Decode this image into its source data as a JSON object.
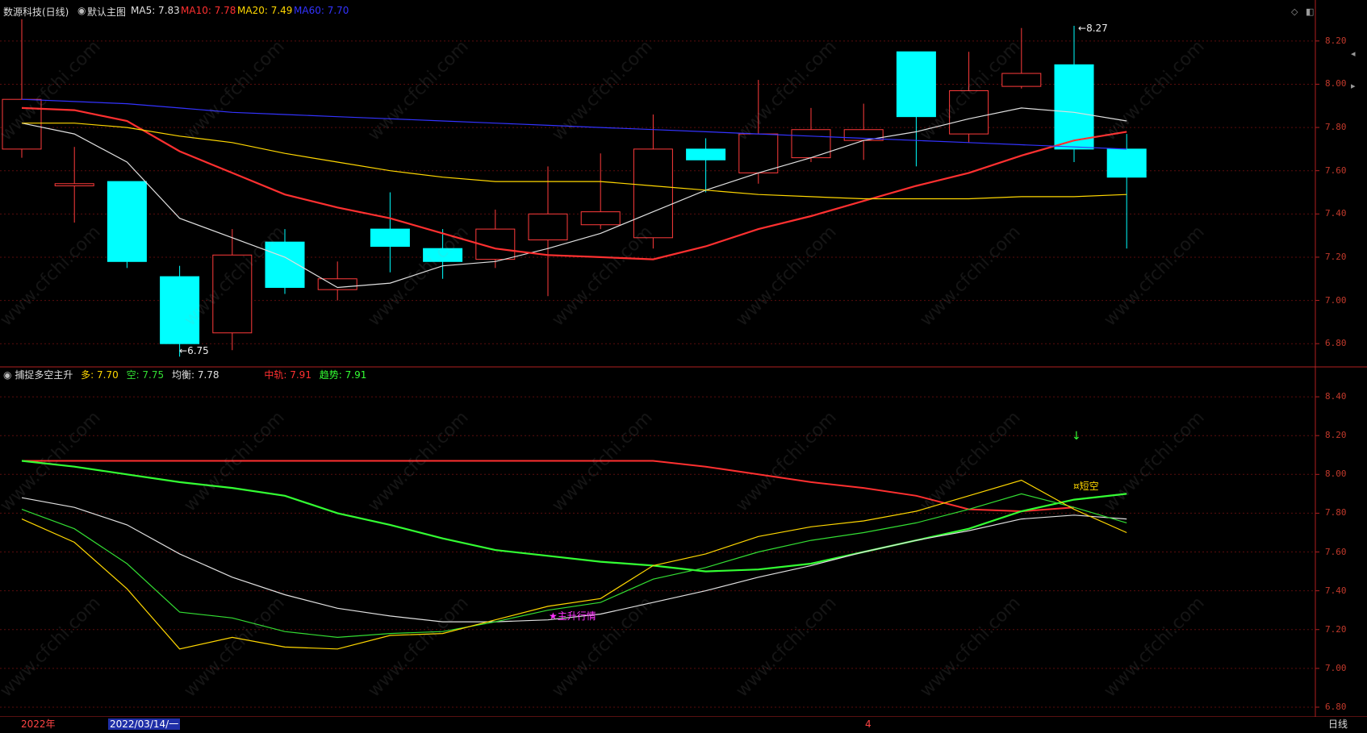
{
  "main_panel": {
    "stock_name": "数源科技(日线)",
    "template_name": "默认主图",
    "ma": [
      {
        "label": "MA5: 7.83",
        "color": "#e0e0e0"
      },
      {
        "label": "MA10: 7.78",
        "color": "#ff3030"
      },
      {
        "label": "MA20: 7.49",
        "color": "#ffd700"
      },
      {
        "label": "MA60: 7.70",
        "color": "#3333ff"
      }
    ],
    "high_marker": "8.27",
    "low_marker": "6.75",
    "axis_ticks": [
      "8.20",
      "8.00",
      "7.80",
      "7.60",
      "7.40",
      "7.20",
      "7.00",
      "6.80"
    ]
  },
  "sub_panel": {
    "indicator_name": "捕捉多空主升",
    "values": [
      {
        "label": "多: 7.70",
        "color": "#ffd700"
      },
      {
        "label": "空: 7.75",
        "color": "#33dd33"
      },
      {
        "label": "均衡: 7.78",
        "color": "#e0e0e0"
      },
      {
        "label": "中轨: 7.91",
        "color": "#ff3030"
      },
      {
        "label": "趋势: 7.91",
        "color": "#33ff33"
      }
    ],
    "signal_short": "短空",
    "signal_main": "主升行情",
    "axis_ticks": [
      "8.40",
      "8.20",
      "8.00",
      "7.80",
      "7.60",
      "7.40",
      "7.20",
      "7.00",
      "6.80"
    ]
  },
  "bottom_bar": {
    "year": "2022年",
    "cursor_date": "2022/03/14/一",
    "month": "4",
    "period": "日线"
  },
  "watermark": "www.cfchi.com",
  "chart_data": [
    {
      "type": "candlestick",
      "title": "数源科技(日线)",
      "ylim": [
        6.7,
        8.3
      ],
      "grid": true,
      "candles": [
        {
          "o": 7.7,
          "h": 8.3,
          "l": 7.66,
          "c": 7.93
        },
        {
          "o": 7.53,
          "h": 7.71,
          "l": 7.36,
          "c": 7.54
        },
        {
          "o": 7.55,
          "h": 7.55,
          "l": 7.15,
          "c": 7.18
        },
        {
          "o": 7.11,
          "h": 7.16,
          "l": 6.74,
          "c": 6.8
        },
        {
          "o": 6.85,
          "h": 7.33,
          "l": 6.77,
          "c": 7.21
        },
        {
          "o": 7.27,
          "h": 7.33,
          "l": 7.03,
          "c": 7.06
        },
        {
          "o": 7.05,
          "h": 7.18,
          "l": 7.0,
          "c": 7.1
        },
        {
          "o": 7.33,
          "h": 7.5,
          "l": 7.13,
          "c": 7.25
        },
        {
          "o": 7.24,
          "h": 7.33,
          "l": 7.1,
          "c": 7.18
        },
        {
          "o": 7.19,
          "h": 7.42,
          "l": 7.15,
          "c": 7.33
        },
        {
          "o": 7.28,
          "h": 7.62,
          "l": 7.02,
          "c": 7.4
        },
        {
          "o": 7.35,
          "h": 7.68,
          "l": 7.33,
          "c": 7.41
        },
        {
          "o": 7.29,
          "h": 7.86,
          "l": 7.24,
          "c": 7.7
        },
        {
          "o": 7.7,
          "h": 7.75,
          "l": 7.5,
          "c": 7.65
        },
        {
          "o": 7.59,
          "h": 8.02,
          "l": 7.54,
          "c": 7.77
        },
        {
          "o": 7.66,
          "h": 7.89,
          "l": 7.64,
          "c": 7.79
        },
        {
          "o": 7.74,
          "h": 7.91,
          "l": 7.65,
          "c": 7.79
        },
        {
          "o": 8.15,
          "h": 8.15,
          "l": 7.62,
          "c": 7.85
        },
        {
          "o": 7.77,
          "h": 8.15,
          "l": 7.73,
          "c": 7.97
        },
        {
          "o": 7.99,
          "h": 8.26,
          "l": 7.98,
          "c": 8.05
        },
        {
          "o": 8.09,
          "h": 8.27,
          "l": 7.64,
          "c": 7.7
        },
        {
          "o": 7.7,
          "h": 7.77,
          "l": 7.24,
          "c": 7.57
        }
      ],
      "series": [
        {
          "name": "MA5",
          "color": "#e0e0e0",
          "values": [
            7.82,
            7.77,
            7.64,
            7.38,
            7.29,
            7.2,
            7.06,
            7.08,
            7.16,
            7.18,
            7.24,
            7.31,
            7.41,
            7.51,
            7.59,
            7.66,
            7.74,
            7.78,
            7.84,
            7.89,
            7.87,
            7.83
          ]
        },
        {
          "name": "MA10",
          "color": "#ff3030",
          "values": [
            7.89,
            7.88,
            7.83,
            7.69,
            7.59,
            7.49,
            7.43,
            7.38,
            7.31,
            7.24,
            7.21,
            7.2,
            7.19,
            7.25,
            7.33,
            7.39,
            7.46,
            7.53,
            7.59,
            7.67,
            7.74,
            7.78
          ]
        },
        {
          "name": "MA20",
          "color": "#ffd700",
          "values": [
            7.82,
            7.82,
            7.8,
            7.76,
            7.73,
            7.68,
            7.64,
            7.6,
            7.57,
            7.55,
            7.55,
            7.55,
            7.53,
            7.51,
            7.49,
            7.48,
            7.47,
            7.47,
            7.47,
            7.48,
            7.48,
            7.49
          ]
        },
        {
          "name": "MA60",
          "color": "#3333ff",
          "values": [
            7.93,
            7.92,
            7.91,
            7.89,
            7.87,
            7.86,
            7.85,
            7.84,
            7.83,
            7.82,
            7.81,
            7.8,
            7.79,
            7.78,
            7.77,
            7.76,
            7.75,
            7.74,
            7.73,
            7.72,
            7.71,
            7.7
          ]
        }
      ]
    },
    {
      "type": "line",
      "title": "捕捉多空主升",
      "ylim": [
        6.75,
        8.55
      ],
      "grid": true,
      "series": [
        {
          "name": "中轨",
          "color": "#ff3030",
          "values": [
            8.07,
            8.07,
            8.07,
            8.07,
            8.07,
            8.07,
            8.07,
            8.07,
            8.07,
            8.07,
            8.07,
            8.07,
            8.07,
            8.04,
            8.0,
            7.96,
            7.93,
            7.89,
            7.82,
            7.81,
            7.83,
            null
          ]
        },
        {
          "name": "趋势",
          "color": "#33ff33",
          "values": [
            8.07,
            8.04,
            8.0,
            7.96,
            7.93,
            7.89,
            7.8,
            7.74,
            7.67,
            7.61,
            7.58,
            7.55,
            7.53,
            7.5,
            7.51,
            7.54,
            7.6,
            7.66,
            7.72,
            7.81,
            7.87,
            7.9
          ]
        },
        {
          "name": "均衡",
          "color": "#e0e0e0",
          "values": [
            7.88,
            7.83,
            7.74,
            7.59,
            7.47,
            7.38,
            7.31,
            7.27,
            7.24,
            7.24,
            7.25,
            7.28,
            7.34,
            7.4,
            7.47,
            7.53,
            7.6,
            7.66,
            7.71,
            7.77,
            7.79,
            7.77
          ]
        },
        {
          "name": "空",
          "color": "#33dd33",
          "values": [
            7.82,
            7.72,
            7.54,
            7.29,
            7.26,
            7.19,
            7.16,
            7.18,
            7.19,
            7.24,
            7.3,
            7.34,
            7.46,
            7.52,
            7.6,
            7.66,
            7.7,
            7.75,
            7.82,
            7.9,
            7.83,
            7.75
          ]
        },
        {
          "name": "多",
          "color": "#ffd700",
          "values": [
            7.77,
            7.65,
            7.41,
            7.1,
            7.16,
            7.11,
            7.1,
            7.17,
            7.18,
            7.25,
            7.32,
            7.36,
            7.53,
            7.59,
            7.68,
            7.73,
            7.76,
            7.81,
            7.89,
            7.97,
            7.82,
            7.7
          ]
        }
      ]
    }
  ]
}
